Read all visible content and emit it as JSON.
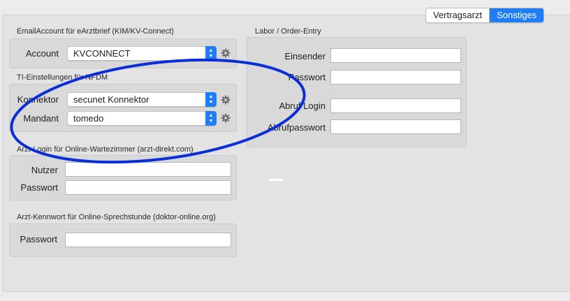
{
  "tabs": [
    {
      "label": "Vertragsarzt",
      "active": false
    },
    {
      "label": "Sonstiges",
      "active": true
    }
  ],
  "email_account": {
    "title": "EmailAccount für eArztbrief (KIM/KV-Connect)",
    "account_label": "Account",
    "account_value": "KVCONNECT"
  },
  "ti": {
    "title": "TI-Einstellungen für NFDM",
    "konnektor_label": "Konnektor",
    "konnektor_value": "secunet Konnektor",
    "mandant_label": "Mandant",
    "mandant_value": "tomedo"
  },
  "arzt_login": {
    "title": "Arzt-Login für Online-Wartezimmer (arzt-direkt.com)",
    "nutzer_label": "Nutzer",
    "passwort_label": "Passwort"
  },
  "arzt_kennwort": {
    "title": "Arzt-Kennwort für Online-Sprechstunde (doktor-online.org)",
    "passwort_label": "Passwort"
  },
  "labor": {
    "title": "Labor / Order-Entry",
    "einsender_label": "Einsender",
    "passwort_label": "Passwort",
    "abruf_login_label": "Abruf Login",
    "abrufpasswort_label": "Abrufpasswort"
  },
  "colors": {
    "accent": "#1f7ef6",
    "annotation": "#0b2fd6"
  }
}
